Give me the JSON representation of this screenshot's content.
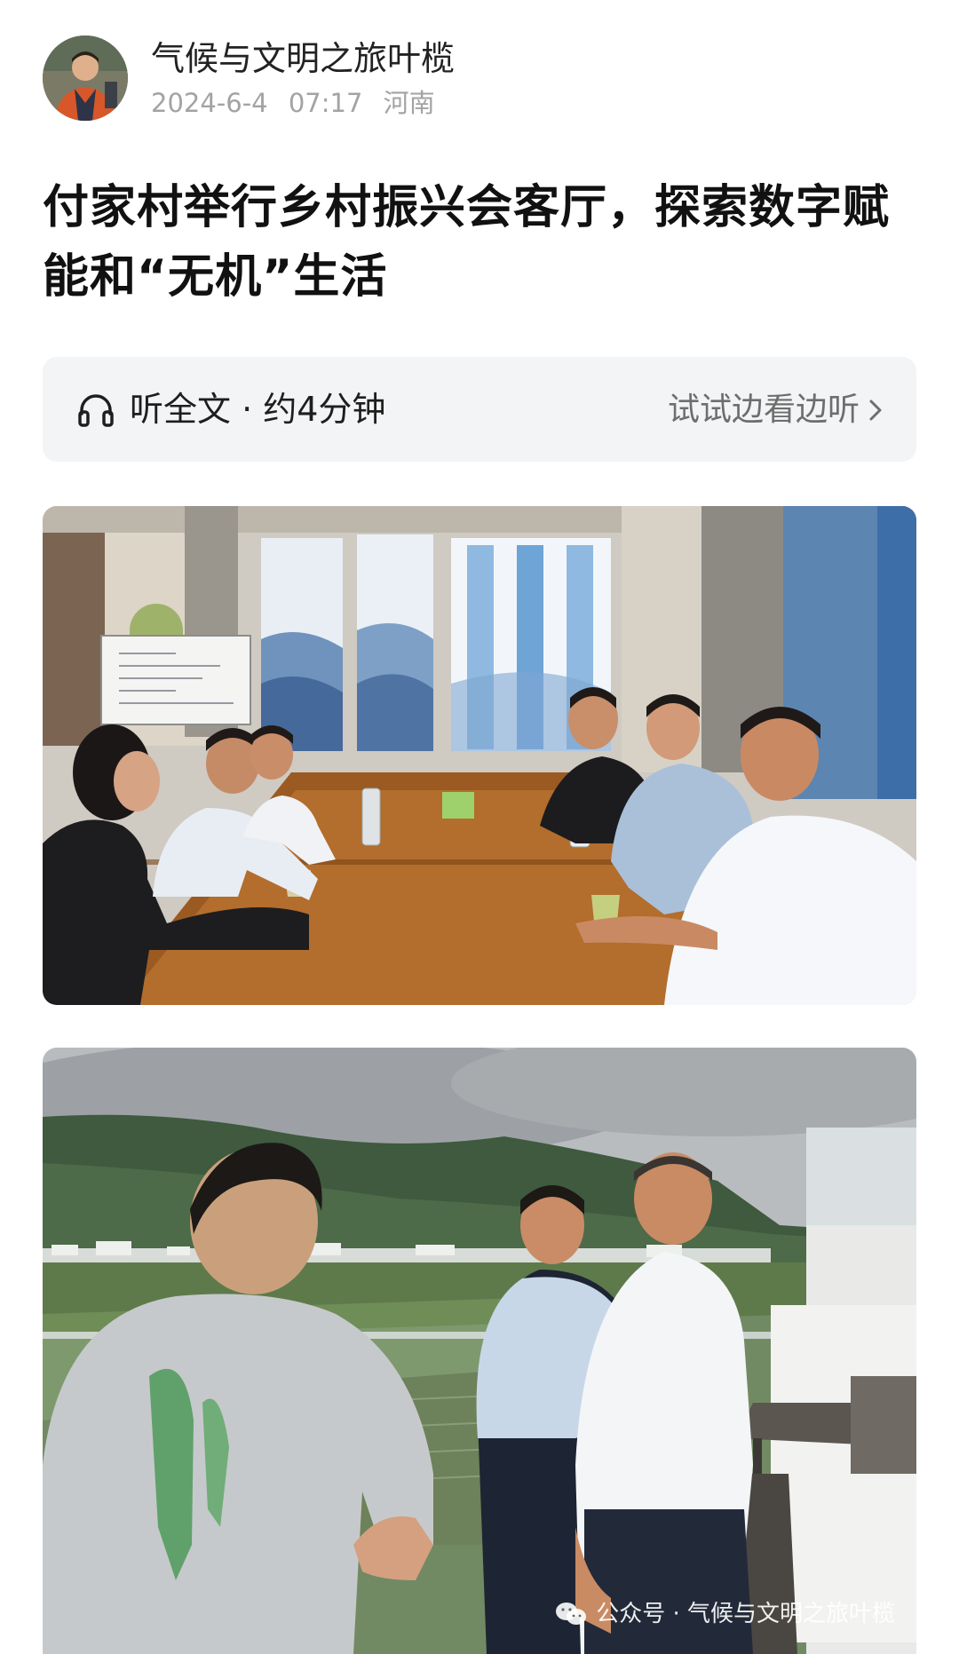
{
  "author": {
    "name": "气候与文明之旅叶榄",
    "date": "2024-6-4",
    "time": "07:17",
    "location": "河南"
  },
  "article": {
    "title": "付家村举行乡村振兴会客厅，探索数字赋能和“无机”生活"
  },
  "listen_bar": {
    "label": "听全文 · 约4分钟",
    "action": "试试边看边听",
    "icon": "headphone-icon"
  },
  "photos": [
    {
      "subject": "meeting-room"
    },
    {
      "subject": "terrace-conversation"
    }
  ],
  "watermark": {
    "text": "公众号 · 气候与文明之旅叶榄",
    "icon": "wechat-icon"
  },
  "colors": {
    "background": "#ffffff",
    "listen_bar_bg": "#f3f4f6",
    "meta_text": "#a3a3a3",
    "title_text": "#111111"
  }
}
